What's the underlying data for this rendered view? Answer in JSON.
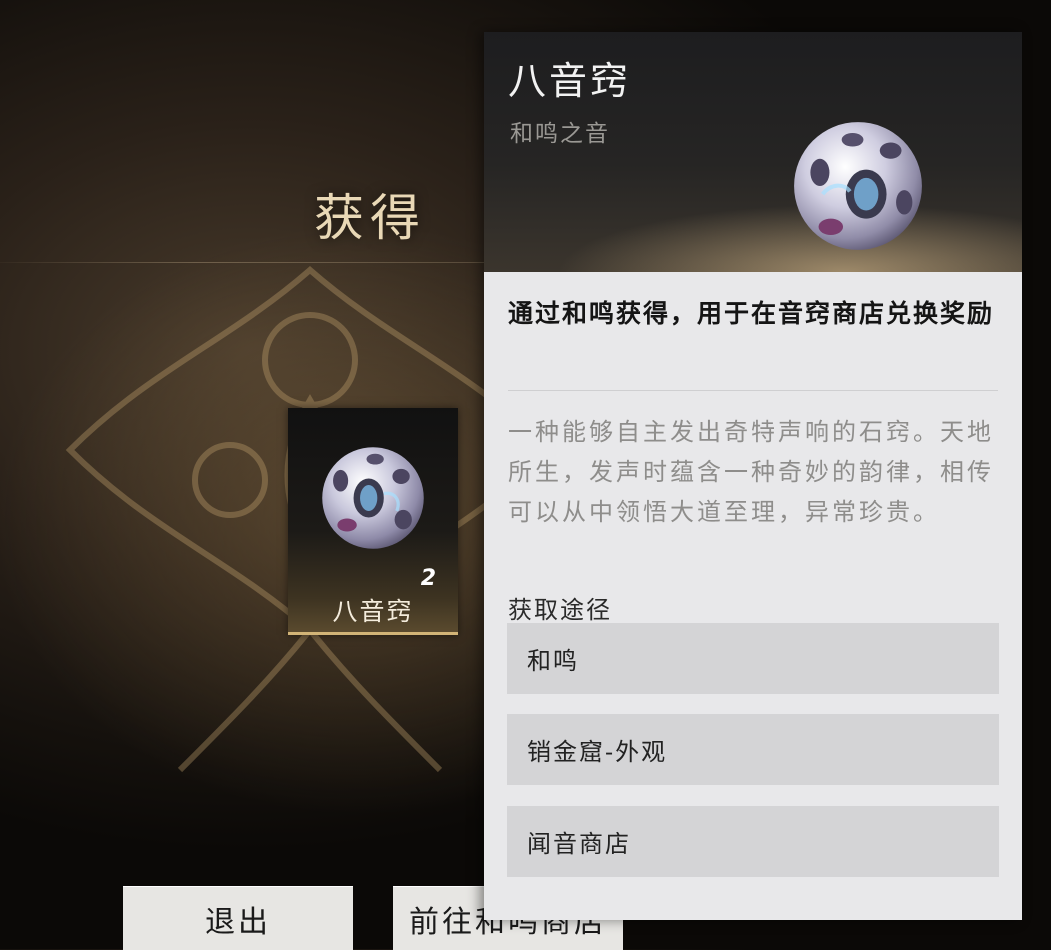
{
  "obtain_title": "获得",
  "item_card": {
    "name": "八音窍",
    "count": "2",
    "icon": "stone-orb-icon"
  },
  "buttons": {
    "exit": "退出",
    "go_shop": "前往和鸣商店"
  },
  "detail": {
    "title": "八音窍",
    "subtitle": "和鸣之音",
    "summary": "通过和鸣获得，用于在音窍商店兑换奖励",
    "description": "一种能够自主发出奇特声响的石窍。天地所生，发声时蕴含一种奇妙的韵律，相传可以从中领悟大道至理，异常珍贵。",
    "source_label": "获取途径",
    "sources": [
      "和鸣",
      "销金窟-外观",
      "闻音商店"
    ]
  },
  "colors": {
    "gold_accent": "#d2b477",
    "panel_bg": "#e8e8ea",
    "row_bg": "#d4d4d6"
  }
}
